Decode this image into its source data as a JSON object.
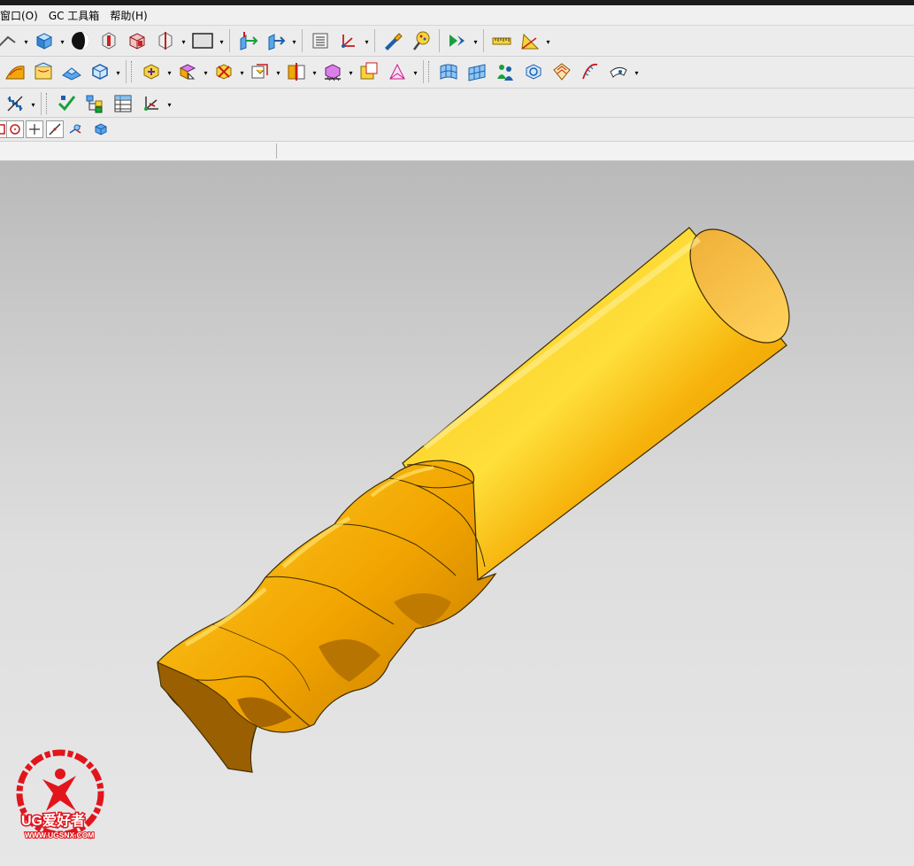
{
  "menu": [
    "窗口(O)",
    "GC 工具箱",
    "帮助(H)"
  ],
  "toolbars": {
    "row1": [
      "curve-icon",
      "block-icon",
      "shade-sphere-icon",
      "section-red-icon",
      "block-red-icon",
      "section-clip-icon",
      "background-color-icon",
      "move-copy-icon",
      "extrude-arrow-icon",
      "layer-settings-icon",
      "csys-icon",
      "edit-object-icon",
      "paint-analysis-icon",
      "render-play-icon",
      "measure-ruler-icon",
      "angle-measure-icon"
    ],
    "row2": [
      "surface-patch-icon",
      "through-curves-icon",
      "ruled-solid-icon",
      "view-cube-icon",
      "blend-edges-icon",
      "draft-icon",
      "trim-body-icon",
      "offset-face-icon",
      "split-body-icon",
      "sew-icon",
      "solid-pyramid-icon",
      "curve-grid-icon",
      "surface-grid-icon",
      "analysis-people-icon",
      "face-analysis-icon",
      "reflection-icon",
      "curvature-icon",
      "section-view-icon"
    ],
    "row3": [
      "fastener-icon",
      "check-geometry-icon",
      "assembly-tree-icon",
      "table-icon",
      "axis-view-icon"
    ]
  },
  "selection_bar": [
    "snap-endpoint-icon",
    "snap-center-icon",
    "snap-point-icon",
    "snap-line-icon",
    "snap-angle-icon",
    "work-view-icon"
  ],
  "colors": {
    "model": "#f2aa06",
    "model_shadow": "#9a5f00",
    "model_highlight": "#ffe36a",
    "watermark": "#e2141c"
  },
  "watermark": {
    "title": "UG爱好者",
    "url": "WWW.UGSNX.COM"
  }
}
